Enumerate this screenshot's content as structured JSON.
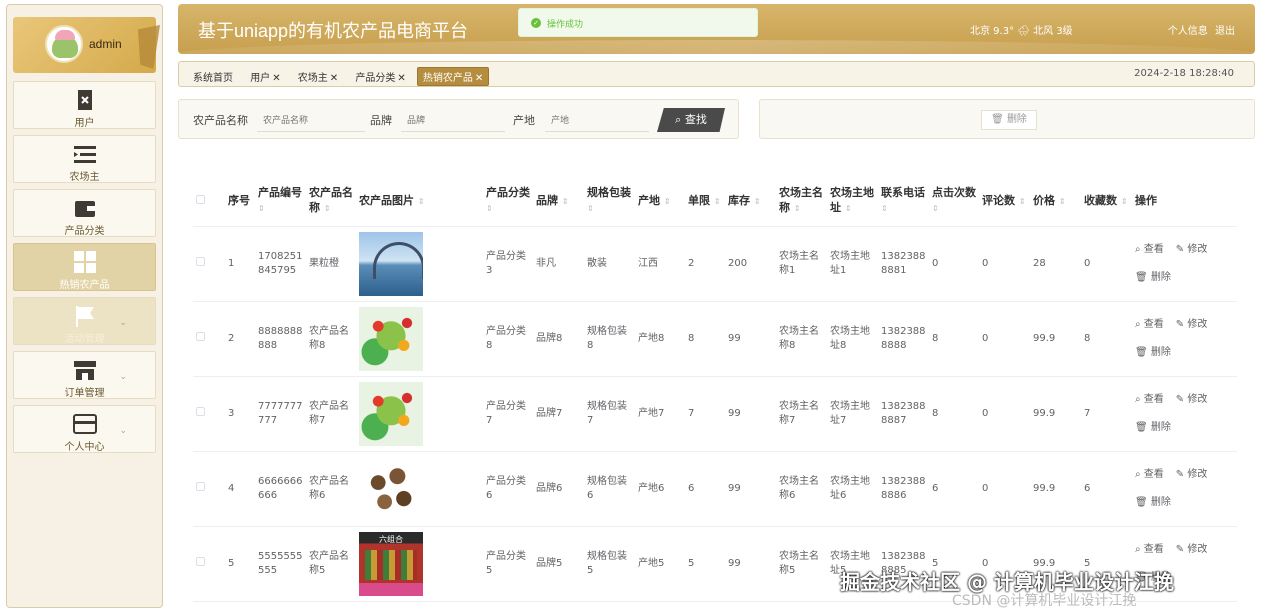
{
  "sidebar": {
    "username": "admin",
    "items": [
      {
        "label": "用户",
        "icon": "user-icon"
      },
      {
        "label": "农场主",
        "icon": "list-icon"
      },
      {
        "label": "产品分类",
        "icon": "wallet-icon"
      },
      {
        "label": "热销农产品",
        "icon": "grid-icon"
      },
      {
        "label": "活动管理",
        "icon": "flag-icon"
      },
      {
        "label": "订单管理",
        "icon": "shop-icon"
      },
      {
        "label": "个人中心",
        "icon": "card-icon"
      }
    ]
  },
  "header": {
    "title": "基于uniapp的有机农产品电商平台",
    "weather": "北京 9.3° 🌧 北风 3级",
    "profile_link": "个人信息",
    "logout_link": "退出",
    "toast": "操作成功"
  },
  "tabs": [
    "系统首页",
    "用户",
    "农场主",
    "产品分类",
    "热销农产品"
  ],
  "clock": "2024-2-18 18:28:40",
  "search": {
    "name_label": "农产品名称",
    "name_placeholder": "农产品名称",
    "brand_label": "品牌",
    "brand_placeholder": "品牌",
    "origin_label": "产地",
    "origin_placeholder": "产地",
    "find_button": "查找",
    "delete_button": "删除"
  },
  "table": {
    "headers": [
      "序号",
      "产品编号",
      "农产品名称",
      "农产品图片",
      "产品分类",
      "品牌",
      "规格包装",
      "产地",
      "单限",
      "库存",
      "农场主名称",
      "农场主地址",
      "联系电话",
      "点击次数",
      "评论数",
      "价格",
      "收藏数",
      "操作"
    ],
    "ops": {
      "view": "查看",
      "edit": "修改",
      "delete": "删除"
    },
    "rows": [
      {
        "idx": "1",
        "code": "1708251845795",
        "name": "果粒橙",
        "img": "lake",
        "cat": "产品分类3",
        "brand": "非凡",
        "pack": "散装",
        "origin": "江西",
        "limit": "2",
        "stock": "200",
        "owner": "农场主名称1",
        "addr": "农场主地址1",
        "phone": "13823888881",
        "clicks": "0",
        "comments": "0",
        "price": "28",
        "fav": "0"
      },
      {
        "idx": "2",
        "code": "8888888888",
        "name": "农产品名称8",
        "img": "veg",
        "cat": "产品分类8",
        "brand": "品牌8",
        "pack": "规格包装8",
        "origin": "产地8",
        "limit": "8",
        "stock": "99",
        "owner": "农场主名称8",
        "addr": "农场主地址8",
        "phone": "13823888888",
        "clicks": "8",
        "comments": "0",
        "price": "99.9",
        "fav": "8"
      },
      {
        "idx": "3",
        "code": "7777777777",
        "name": "农产品名称7",
        "img": "veg",
        "cat": "产品分类7",
        "brand": "品牌7",
        "pack": "规格包装7",
        "origin": "产地7",
        "limit": "7",
        "stock": "99",
        "owner": "农场主名称7",
        "addr": "农场主地址7",
        "phone": "13823888887",
        "clicks": "8",
        "comments": "0",
        "price": "99.9",
        "fav": "7"
      },
      {
        "idx": "4",
        "code": "6666666666",
        "name": "农产品名称6",
        "img": "mush",
        "cat": "产品分类6",
        "brand": "品牌6",
        "pack": "规格包装6",
        "origin": "产地6",
        "limit": "6",
        "stock": "99",
        "owner": "农场主名称6",
        "addr": "农场主地址6",
        "phone": "13823888886",
        "clicks": "6",
        "comments": "0",
        "price": "99.9",
        "fav": "6"
      },
      {
        "idx": "5",
        "code": "5555555555",
        "name": "农产品名称5",
        "img": "box",
        "cat": "产品分类5",
        "brand": "品牌5",
        "pack": "规格包装5",
        "origin": "产地5",
        "limit": "5",
        "stock": "99",
        "owner": "农场主名称5",
        "addr": "农场主地址5",
        "phone": "13823888885",
        "clicks": "5",
        "comments": "0",
        "price": "99.9",
        "fav": "5"
      }
    ],
    "box_img_text": "六组合"
  },
  "watermark": "掘金技术社区 @ 计算机毕业设计江挽",
  "watermark2": "CSDN @计算机毕业设计江挽"
}
